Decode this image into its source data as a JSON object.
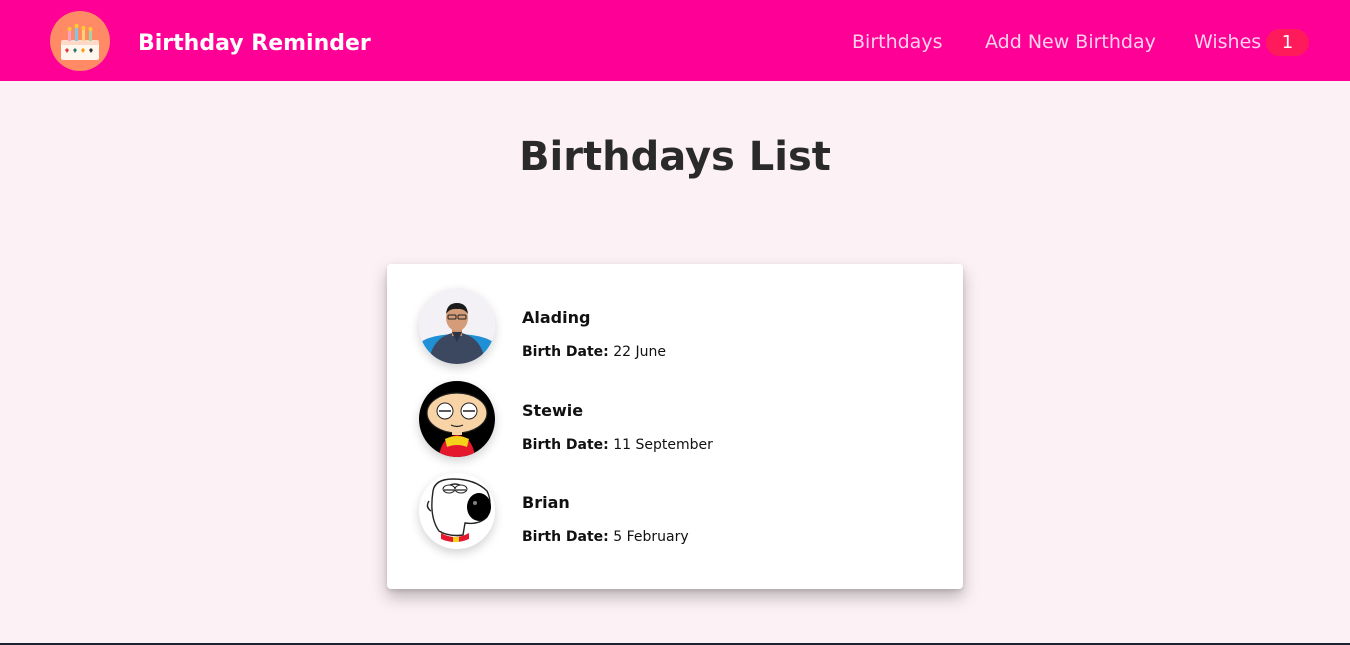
{
  "brand": {
    "name": "Birthday Reminder",
    "logo_icon": "birthday-cake-icon",
    "logo_bg": "#ff8a65"
  },
  "nav": {
    "birthdays": "Birthdays",
    "add_new": "Add New Birthday",
    "wishes": "Wishes",
    "wishes_count": "1"
  },
  "colors": {
    "navbar": "#ff0096",
    "badge": "#ff1a5c",
    "page_bg": "#fcf1f5"
  },
  "page": {
    "title": "Birthdays List"
  },
  "birthdays": [
    {
      "name": "Alading",
      "date_label": "Birth Date:",
      "date": "22 June",
      "avatar": "man-photo-avatar"
    },
    {
      "name": "Stewie",
      "date_label": "Birth Date:",
      "date": "11 September",
      "avatar": "stewie-cartoon-avatar"
    },
    {
      "name": "Brian",
      "date_label": "Birth Date:",
      "date": "5 February",
      "avatar": "brian-dog-cartoon-avatar"
    }
  ]
}
